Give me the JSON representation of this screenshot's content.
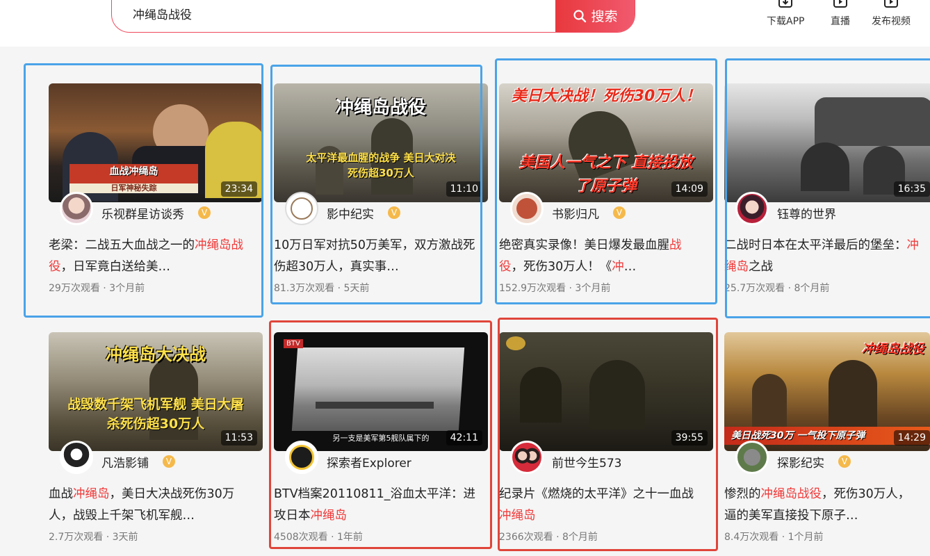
{
  "search": {
    "value": "冲绳岛战役",
    "button_label": "搜索"
  },
  "header_actions": [
    {
      "label": "下载APP",
      "icon": "download-icon"
    },
    {
      "label": "直播",
      "icon": "live-icon"
    },
    {
      "label": "发布视频",
      "icon": "upload-video-icon"
    }
  ],
  "videos": [
    {
      "duration": "23:34",
      "author": "乐视群星访谈秀",
      "verified": true,
      "title_parts": [
        "老梁：二战五大血战之一的",
        "冲绳岛战役",
        "，日军竟白送给美…"
      ],
      "meta": "29万次观看 · 3个月前",
      "thumb_text": "血战冲绳岛",
      "thumb_sub": "日军神秘失踪"
    },
    {
      "duration": "11:10",
      "author": "影中纪实",
      "verified": true,
      "title_parts": [
        "10万日军对抗50万美军，双方激战死伤超30万人，真实事…"
      ],
      "meta": "81.3万次观看 · 5天前",
      "thumb_text": "冲绳岛战役",
      "thumb_sub": "太平洋最血腥的战争 美日大对决 死伤超30万人"
    },
    {
      "duration": "14:09",
      "author": "书影归凡",
      "verified": true,
      "title_parts": [
        "绝密真实录像！美日爆发最血腥",
        "战役",
        "，死伤30万人！《",
        "冲",
        "…"
      ],
      "meta": "152.9万次观看 · 3个月前",
      "thumb_text": "美日大决战！死伤30万人！",
      "thumb_sub": "美国人一气之下 直接投放了原子弹"
    },
    {
      "duration": "16:35",
      "author": "钰尊的世界",
      "verified": false,
      "title_parts": [
        "二战时日本在太平洋最后的堡垒：",
        "冲绳岛",
        "之战"
      ],
      "meta": "25.7万次观看 · 8个月前",
      "thumb_text": "",
      "thumb_sub": ""
    },
    {
      "duration": "11:53",
      "author": "凡浩影铺",
      "verified": true,
      "title_parts": [
        "血战",
        "冲绳岛",
        "，美日大决战死伤30万人，战毁上千架飞机军舰…"
      ],
      "meta": "2.7万次观看 · 3天前",
      "thumb_text": "冲绳岛大决战",
      "thumb_sub": "战毁数千架飞机军舰 美日大屠杀死伤超30万人"
    },
    {
      "duration": "42:11",
      "author": "探索者Explorer",
      "verified": false,
      "title_parts": [
        "BTV档案20110811_浴血太平洋：进攻日本",
        "冲绳岛"
      ],
      "meta": "4508次观看 · 1年前",
      "thumb_text": "",
      "thumb_sub": "另一支是美军第5舰队属下的"
    },
    {
      "duration": "39:55",
      "author": "前世今生573",
      "verified": false,
      "title_parts": [
        "纪录片《燃烧的太平洋》之十一血战",
        "冲绳岛"
      ],
      "meta": "2366次观看 · 8个月前",
      "thumb_text": "",
      "thumb_sub": ""
    },
    {
      "duration": "14:29",
      "author": "探影纪实",
      "verified": true,
      "title_parts": [
        "惨烈的",
        "冲绳岛战役",
        "，死伤30万人，逼的美军直接投下原子…"
      ],
      "meta": "8.4万次观看 · 1个月前",
      "thumb_text": "冲绳岛战役",
      "thumb_sub": "美日战死30万 一气投下原子弹"
    }
  ],
  "colors": {
    "accent": "#f04a5c",
    "highlight_text": "#f03b3b",
    "box_blue": "#4aa3e8",
    "box_red": "#e0453a"
  }
}
